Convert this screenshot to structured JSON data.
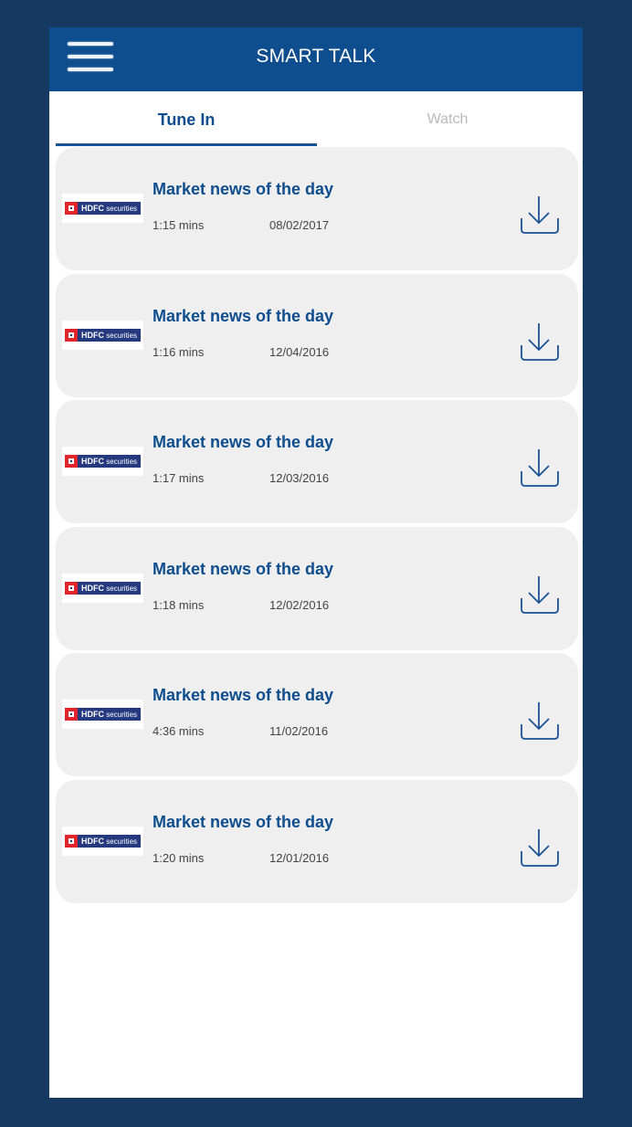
{
  "header": {
    "title": "SMART TALK",
    "menu_icon": "hamburger-menu-icon"
  },
  "tabs": [
    {
      "label": "Tune In",
      "active": true
    },
    {
      "label": "Watch",
      "active": false
    }
  ],
  "colors": {
    "brand_blue": "#0e4d8e",
    "frame_bg": "#163962",
    "card_bg": "#efefef",
    "inactive_tab": "#b9b9b9"
  },
  "episodes": [
    {
      "logo": {
        "brand": "HDFC",
        "sub": "securities"
      },
      "title": "Market news of the day",
      "duration": "1:15 mins",
      "date": "08/02/2017",
      "action_icon": "download-icon"
    },
    {
      "logo": {
        "brand": "HDFC",
        "sub": "securities"
      },
      "title": "Market news of the day",
      "duration": "1:16 mins",
      "date": "12/04/2016",
      "action_icon": "download-icon"
    },
    {
      "logo": {
        "brand": "HDFC",
        "sub": "securities"
      },
      "title": "Market news of the day",
      "duration": "1:17 mins",
      "date": "12/03/2016",
      "action_icon": "download-icon"
    },
    {
      "logo": {
        "brand": "HDFC",
        "sub": "securities"
      },
      "title": "Market news of the day",
      "duration": "1:18 mins",
      "date": "12/02/2016",
      "action_icon": "download-icon"
    },
    {
      "logo": {
        "brand": "HDFC",
        "sub": "securities"
      },
      "title": "Market news of the day",
      "duration": "4:36 mins",
      "date": "11/02/2016",
      "action_icon": "download-icon"
    },
    {
      "logo": {
        "brand": "HDFC",
        "sub": "securities"
      },
      "title": "Market news of the day",
      "duration": "1:20 mins",
      "date": "12/01/2016",
      "action_icon": "download-icon"
    }
  ]
}
